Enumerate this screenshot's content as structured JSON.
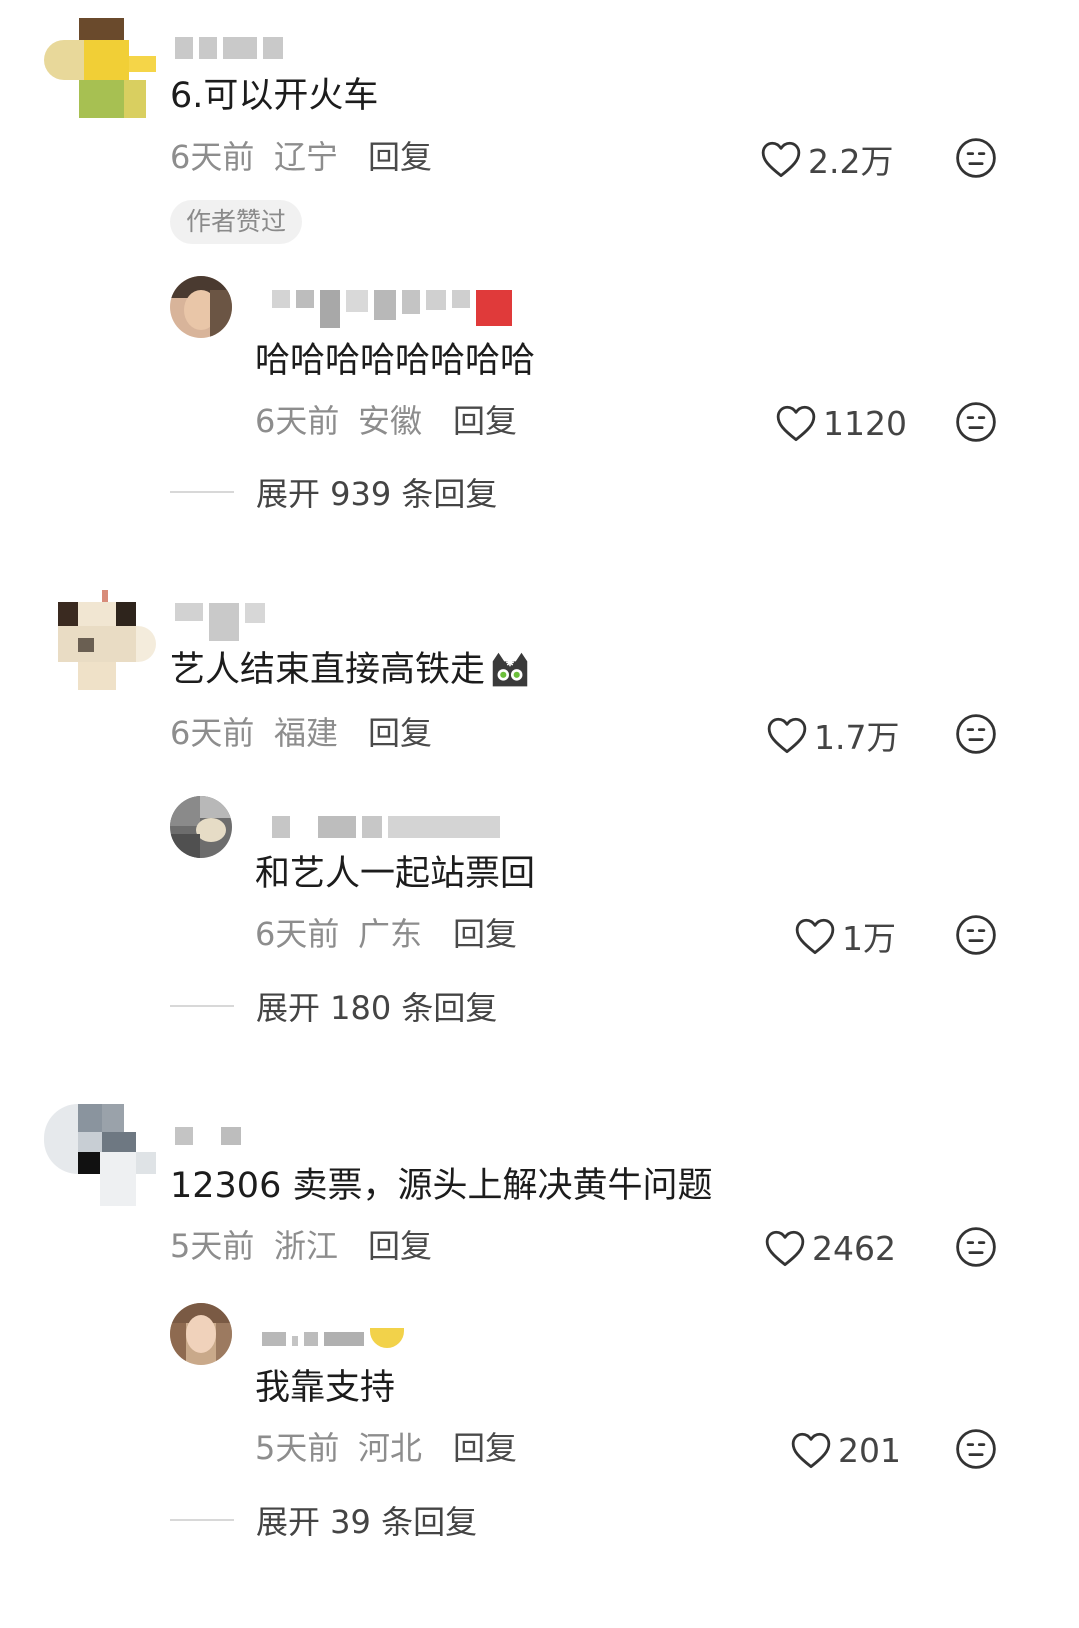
{
  "comments": [
    {
      "text": "6.可以开火车",
      "time": "6天前",
      "location": "辽宁",
      "reply_label": "回复",
      "likes": "2.2万",
      "author_tag": "作者赞过",
      "reply": {
        "text": "哈哈哈哈哈哈哈哈",
        "time": "6天前",
        "location": "安徽",
        "reply_label": "回复",
        "likes": "1120"
      },
      "expand_label": "展开 939 条回复"
    },
    {
      "text": "艺人结束直接高铁走",
      "time": "6天前",
      "location": "福建",
      "reply_label": "回复",
      "likes": "1.7万",
      "reply": {
        "text": "和艺人一起站票回",
        "time": "6天前",
        "location": "广东",
        "reply_label": "回复",
        "likes": "1万"
      },
      "expand_label": "展开 180 条回复"
    },
    {
      "text": "12306 卖票，源头上解决黄牛问题",
      "time": "5天前",
      "location": "浙江",
      "reply_label": "回复",
      "likes": "2462",
      "reply": {
        "text": "我靠支持",
        "time": "5天前",
        "location": "河北",
        "reply_label": "回复",
        "likes": "201"
      },
      "expand_label": "展开 39 条回复"
    }
  ],
  "icons": {
    "like": "heart-outline-icon",
    "dislike": "neutral-face-icon",
    "emoji": "cat-emoji-icon"
  },
  "colors": {
    "text": "#1c1c1c",
    "meta": "#8d8d8d",
    "tag_bg": "#f1f1f1"
  }
}
